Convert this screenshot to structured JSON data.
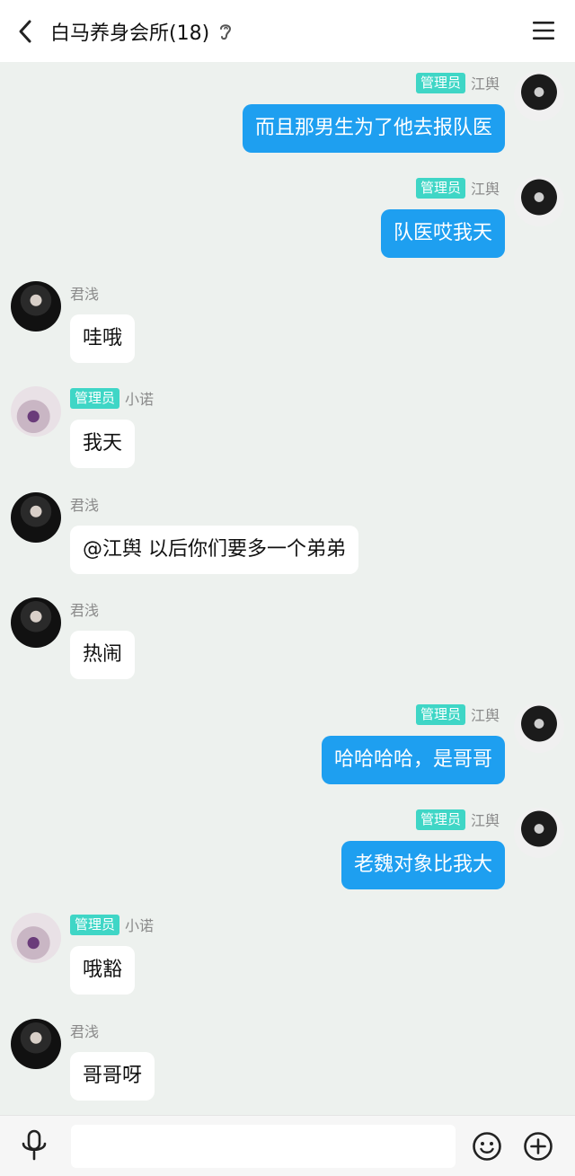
{
  "header": {
    "title": "白马养身会所(18)"
  },
  "roles": {
    "admin": "管理员"
  },
  "messages": [
    {
      "side": "right",
      "sender": "江舆",
      "admin": true,
      "text": "而且那男生为了他去报队医"
    },
    {
      "side": "right",
      "sender": "江舆",
      "admin": true,
      "text": "队医哎我天"
    },
    {
      "side": "left",
      "sender": "君浅",
      "admin": false,
      "text": "哇哦"
    },
    {
      "side": "left",
      "sender": "小诺",
      "admin": true,
      "text": "我天"
    },
    {
      "side": "left",
      "sender": "君浅",
      "admin": false,
      "text": "@江舆 以后你们要多一个弟弟"
    },
    {
      "side": "left",
      "sender": "君浅",
      "admin": false,
      "text": "热闹"
    },
    {
      "side": "right",
      "sender": "江舆",
      "admin": true,
      "text": "哈哈哈哈，是哥哥"
    },
    {
      "side": "right",
      "sender": "江舆",
      "admin": true,
      "text": "老魏对象比我大"
    },
    {
      "side": "left",
      "sender": "小诺",
      "admin": true,
      "text": "哦豁"
    },
    {
      "side": "left",
      "sender": "君浅",
      "admin": false,
      "text": "哥哥呀"
    }
  ],
  "input": {
    "value": "",
    "placeholder": ""
  },
  "colors": {
    "accent": "#1e9ff0",
    "badge": "#3fd6c6",
    "background": "#edf1ee"
  },
  "icons": {
    "back": "chevron-left-icon",
    "menu": "hamburger-menu-icon",
    "ear": "ear-icon",
    "mic": "microphone-icon",
    "emoji": "smiley-icon",
    "plus": "plus-circle-icon"
  }
}
